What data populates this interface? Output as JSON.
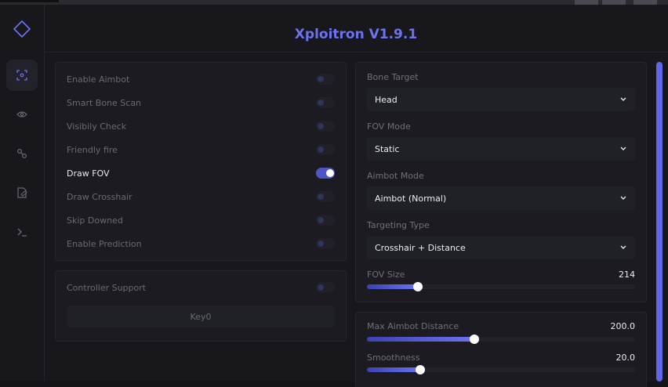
{
  "app": {
    "title": "Xploitron V1.9.1"
  },
  "sidebar": {
    "items": [
      {
        "icon": "crosshair-icon",
        "active": true
      },
      {
        "icon": "eye-icon",
        "active": false
      },
      {
        "icon": "misc-icon",
        "active": false
      },
      {
        "icon": "config-icon",
        "active": false
      },
      {
        "icon": "terminal-icon",
        "active": false
      }
    ]
  },
  "toggles": [
    {
      "label": "Enable Aimbot",
      "on": false
    },
    {
      "label": "Smart Bone Scan",
      "on": false
    },
    {
      "label": "Visibily Check",
      "on": false
    },
    {
      "label": "Friendly fire",
      "on": false
    },
    {
      "label": "Draw FOV",
      "on": true
    },
    {
      "label": "Draw Crosshair",
      "on": false
    },
    {
      "label": "Skip Downed",
      "on": false
    },
    {
      "label": "Enable Prediction",
      "on": false
    }
  ],
  "controller": {
    "label": "Controller Support",
    "on": false,
    "key_label": "Key0"
  },
  "selects": [
    {
      "label": "Bone Target",
      "value": "Head"
    },
    {
      "label": "FOV Mode",
      "value": "Static"
    },
    {
      "label": "Aimbot Mode",
      "value": "Aimbot (Normal)"
    },
    {
      "label": "Targeting Type",
      "value": "Crosshair + Distance"
    }
  ],
  "fov_size": {
    "label": "FOV Size",
    "value": "214",
    "fraction": 0.19
  },
  "sliders": [
    {
      "label": "Max Aimbot Distance",
      "value": "200.0",
      "fraction": 0.4
    },
    {
      "label": "Smoothness",
      "value": "20.0",
      "fraction": 0.2
    }
  ],
  "colors": {
    "accent": "#6c73f0",
    "background": "#17171c",
    "card": "#1b1b21"
  }
}
